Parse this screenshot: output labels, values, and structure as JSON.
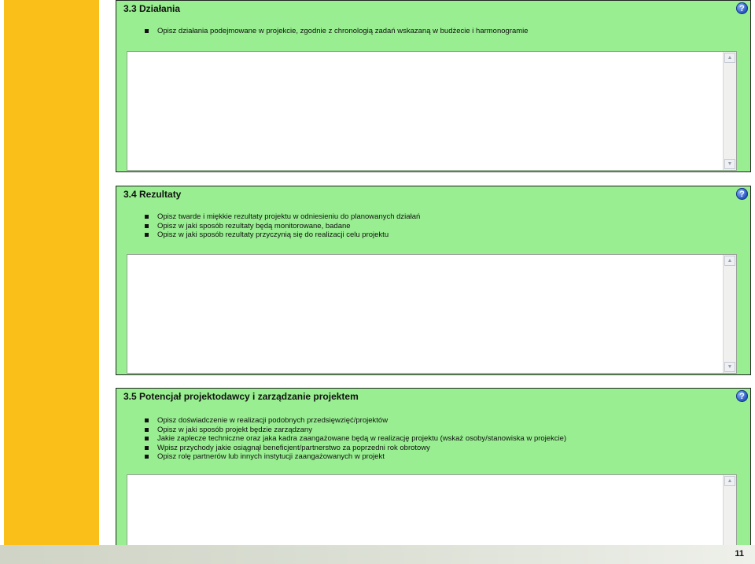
{
  "sections": [
    {
      "title": "3.3 Działania",
      "bullets": [
        "Opisz działania podejmowane w projekcie, zgodnie z chronologią zadań wskazaną w budżecie i harmonogramie"
      ]
    },
    {
      "title": "3.4 Rezultaty",
      "bullets": [
        "Opisz twarde i miękkie rezultaty projektu w odniesieniu do planowanych działań",
        "Opisz w jaki sposób rezultaty będą monitorowane, badane",
        "Opisz w jaki sposób rezultaty przyczynią się do realizacji celu projektu"
      ]
    },
    {
      "title": "3.5 Potencjał projektodawcy i zarządzanie projektem",
      "bullets": [
        "Opisz doświadczenie w realizacji podobnych przedsięwzięć/projektów",
        "Opisz w jaki sposób projekt będzie zarządzany",
        "Jakie zaplecze techniczne oraz jaka kadra zaangażowane będą w realizację projektu (wskaż osoby/stanowiska w projekcie)",
        "Wpisz przychody jakie osiągnął beneficjent/partnerstwo za poprzedni rok obrotowy",
        "Opisz rolę partnerów lub innych instytucji zaangażowanych w projekt"
      ]
    }
  ],
  "help_glyph": "?",
  "page_number": "11",
  "colors": {
    "side_bar": "#fbbf1a",
    "section_bg": "#98ee90"
  }
}
